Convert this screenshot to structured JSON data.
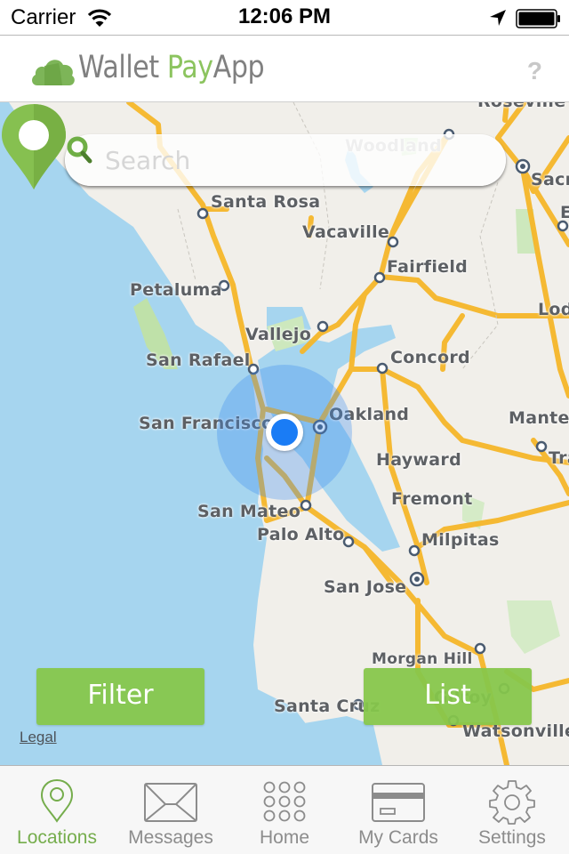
{
  "status_bar": {
    "carrier": "Carrier",
    "time": "12:06 PM",
    "icons": [
      "wifi-icon",
      "location-arrow-icon",
      "battery-icon"
    ]
  },
  "header": {
    "title_part1": "Wallet ",
    "title_part2": "Pay",
    "title_part3": "App",
    "logo_icon": "cloud-logo-icon",
    "help_label": "?",
    "accent_color": "#8cc45f"
  },
  "search": {
    "placeholder": "Search",
    "value": "",
    "icon": "search-icon"
  },
  "map": {
    "labels": [
      {
        "name": "Roseville"
      },
      {
        "name": "Woodland"
      },
      {
        "name": "Sacr"
      },
      {
        "name": "E"
      },
      {
        "name": "Santa Rosa"
      },
      {
        "name": "Vacaville"
      },
      {
        "name": "Fairfield"
      },
      {
        "name": "Petaluma"
      },
      {
        "name": "Lod"
      },
      {
        "name": "Vallejo"
      },
      {
        "name": "San Rafael"
      },
      {
        "name": "Concord"
      },
      {
        "name": "San Francisco"
      },
      {
        "name": "Oakland"
      },
      {
        "name": "Mante"
      },
      {
        "name": "Hayward"
      },
      {
        "name": "Tra"
      },
      {
        "name": "Fremont"
      },
      {
        "name": "San Mateo"
      },
      {
        "name": "Palo Alto"
      },
      {
        "name": "Milpitas"
      },
      {
        "name": "San Jose"
      },
      {
        "name": "Morgan Hill"
      },
      {
        "name": "Gilroy"
      },
      {
        "name": "Santa Cruz"
      },
      {
        "name": "Watsonville"
      }
    ],
    "legal_label": "Legal",
    "user_location_color": "#1a7cf5",
    "pin_color": "#7fba4c"
  },
  "buttons": {
    "filter": "Filter",
    "list": "List"
  },
  "tab_bar": {
    "tabs": [
      {
        "label": "Locations",
        "icon": "location-pin-icon",
        "active": true
      },
      {
        "label": "Messages",
        "icon": "envelope-icon",
        "active": false
      },
      {
        "label": "Home",
        "icon": "grid-dots-icon",
        "active": false
      },
      {
        "label": "My Cards",
        "icon": "credit-card-icon",
        "active": false
      },
      {
        "label": "Settings",
        "icon": "gear-icon",
        "active": false
      }
    ],
    "active_color": "#75ad4c",
    "inactive_color": "#8c8c8c"
  }
}
